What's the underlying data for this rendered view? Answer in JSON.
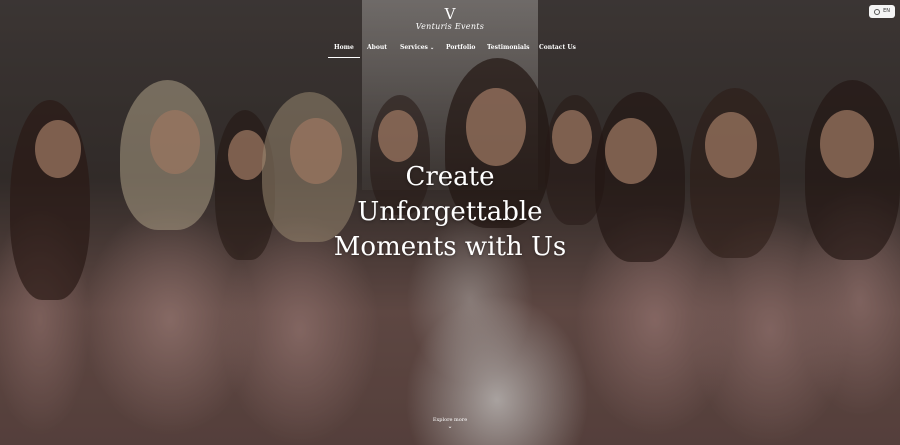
{
  "brand": {
    "mark": "V",
    "name": "Venturis Events"
  },
  "language": {
    "label": "EN",
    "icon": "globe-icon"
  },
  "nav": {
    "items": [
      {
        "label": "Home",
        "active": true
      },
      {
        "label": "About"
      },
      {
        "label": "Services",
        "has_dropdown": true,
        "chevron": "⌄"
      },
      {
        "label": "Portfolio"
      },
      {
        "label": "Testimonials"
      },
      {
        "label": "Contact Us"
      }
    ]
  },
  "hero": {
    "lines": [
      "Create",
      "Unforgettable",
      "Moments with Us"
    ],
    "explore_label": "Explore more",
    "explore_icon": "⌄"
  }
}
